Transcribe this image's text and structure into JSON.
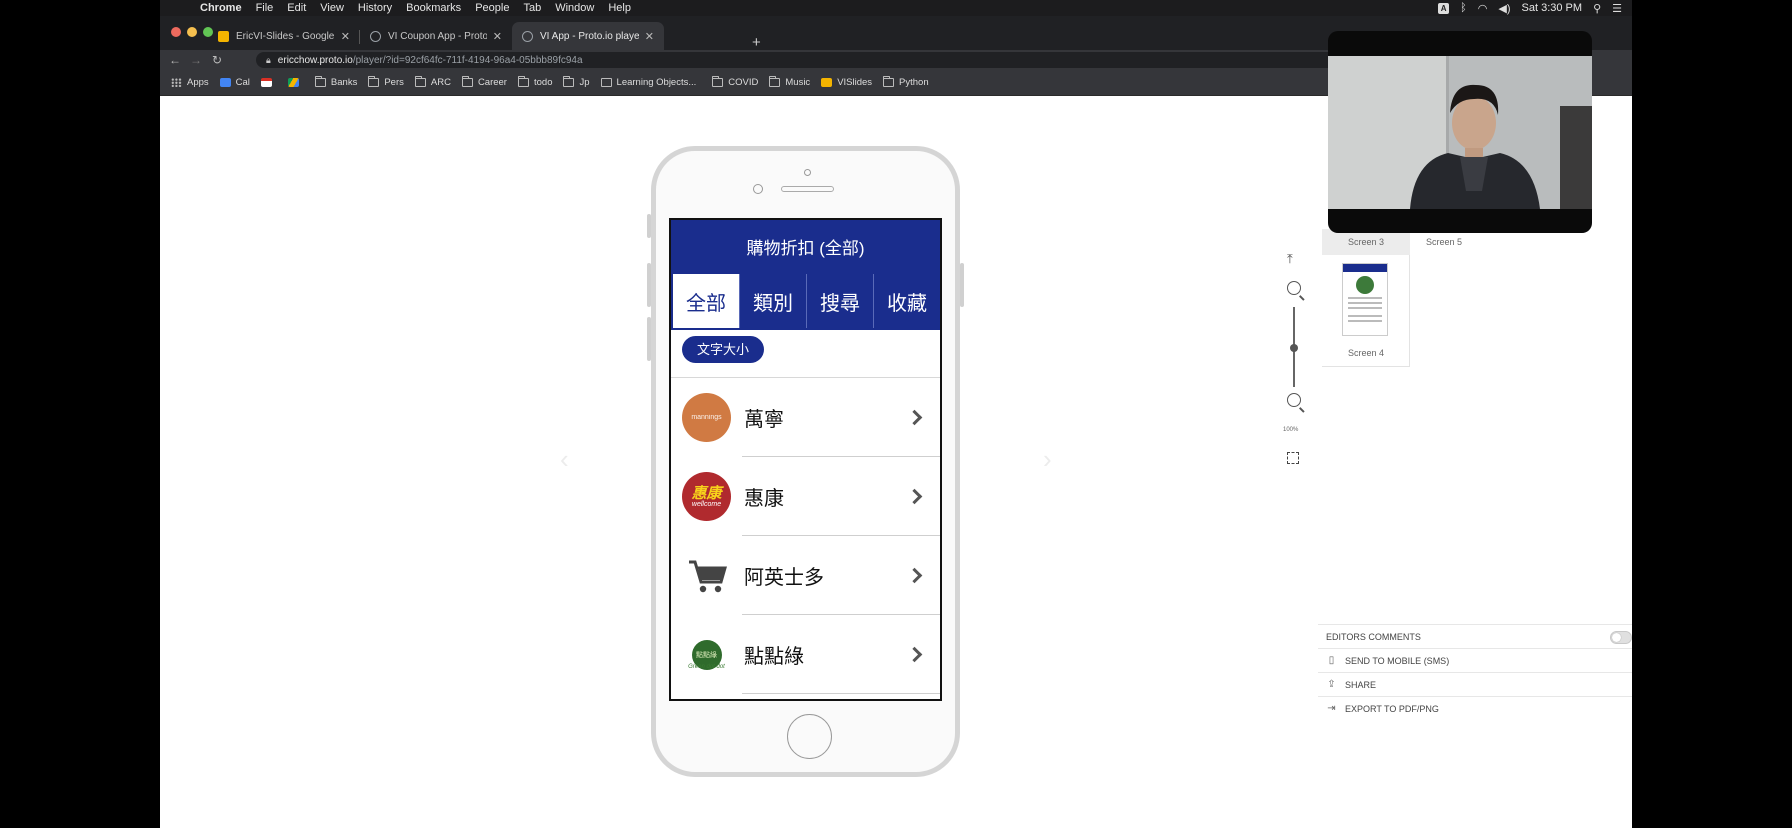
{
  "menubar": {
    "app_name": "Chrome",
    "items": [
      "File",
      "Edit",
      "View",
      "History",
      "Bookmarks",
      "People",
      "Tab",
      "Window",
      "Help"
    ],
    "clock": "Sat 3:30 PM",
    "input_badge": "A"
  },
  "browser": {
    "tabs": [
      {
        "label": "EricVI-Slides - Google Slides",
        "favicon_color": "#f4b400"
      },
      {
        "label": "VI Coupon App - Proto.io editor",
        "favicon_color": "#9aa0a6"
      },
      {
        "label": "VI App - Proto.io player",
        "favicon_color": "#9aa0a6"
      }
    ],
    "url_host": "ericchow.proto.io",
    "url_path": "/player/?id=92cf64fc-711f-4194-96a4-05bbb89fc94a"
  },
  "bookmarks": [
    {
      "label": "Apps",
      "icon": "apps-grid-icon"
    },
    {
      "label": "Cal",
      "icon": "calendar-icon"
    },
    {
      "label": "",
      "icon": "gmail-icon"
    },
    {
      "label": "",
      "icon": "drive-icon"
    },
    {
      "label": "Banks",
      "icon": "folder-icon"
    },
    {
      "label": "Pers",
      "icon": "folder-icon"
    },
    {
      "label": "ARC",
      "icon": "folder-icon"
    },
    {
      "label": "Career",
      "icon": "folder-icon"
    },
    {
      "label": "todo",
      "icon": "folder-icon"
    },
    {
      "label": "Jp",
      "icon": "folder-icon"
    },
    {
      "label": "Learning Objects...",
      "icon": "bookmark-page-icon"
    },
    {
      "label": "COVID",
      "icon": "folder-icon"
    },
    {
      "label": "Music",
      "icon": "folder-icon"
    },
    {
      "label": "VISlides",
      "icon": "slides-icon"
    },
    {
      "label": "Python",
      "icon": "folder-icon"
    }
  ],
  "app": {
    "header_title": "購物折扣 (全部)",
    "tabs": [
      "全部",
      "類別",
      "搜尋",
      "收藏"
    ],
    "active_tab": 0,
    "font_size_button": "文字大小",
    "stores": [
      {
        "name": "萬寧",
        "logo_text": "mannings",
        "logo_color": "#d07a43"
      },
      {
        "name": "惠康",
        "logo_text": "惠康",
        "logo_sub": "wellcome",
        "logo_color": "#b02a2e"
      },
      {
        "name": "阿英士多",
        "logo_text": "",
        "logo_color": "#ffffff"
      },
      {
        "name": "點點綠",
        "logo_text": "點點綠",
        "logo_sub": "Green dot dot",
        "logo_color": "#2f6b2c"
      }
    ],
    "colors": {
      "primary": "#1a2d8d"
    }
  },
  "player_panel": {
    "screens": [
      "Screen 3",
      "Screen 5",
      "Screen 4"
    ],
    "zoom_label": "100%",
    "options": {
      "editors_comments": "EDITORS COMMENTS",
      "send_to_mobile": "SEND TO MOBILE (SMS)",
      "share": "SHARE",
      "export": "EXPORT TO PDF/PNG"
    }
  }
}
